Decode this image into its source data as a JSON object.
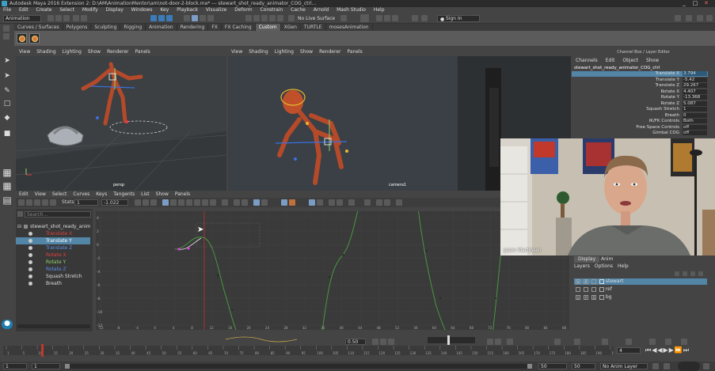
{
  "window": {
    "title": "Autodesk Maya 2016 Extension 2: D:\\AM\\AnimationMentor\\am\\not-door-2-block.ma* --- stewart_shot_ready_animator_COG_ctrl...",
    "controls": [
      "_",
      "□",
      "✕"
    ]
  },
  "menubar": [
    "File",
    "Edit",
    "Create",
    "Select",
    "Modify",
    "Display",
    "Windows",
    "Key",
    "Playback",
    "Visualize",
    "Deform",
    "Constrain",
    "Cache",
    "Arnold",
    "Mash Studio",
    "Help"
  ],
  "statusline": {
    "mode": "Animation",
    "live_surface": "No Live Surface",
    "sign_in": "Sign In"
  },
  "shelf": {
    "tabs": [
      "Curves / Surfaces",
      "Polygons",
      "Sculpting",
      "Rigging",
      "Animation",
      "Rendering",
      "FX",
      "FX Caching",
      "Custom",
      "XGen",
      "TURTLE",
      "mosesAnimation"
    ],
    "active_tab": "Custom"
  },
  "viewports": [
    {
      "menu": [
        "View",
        "Shading",
        "Lighting",
        "Show",
        "Renderer",
        "Panels"
      ],
      "camera": "persp"
    },
    {
      "menu": [
        "View",
        "Shading",
        "Lighting",
        "Show",
        "Renderer",
        "Panels"
      ],
      "camera": "camera1"
    }
  ],
  "graph_editor": {
    "menu": [
      "Edit",
      "View",
      "Select",
      "Curves",
      "Keys",
      "Tangents",
      "List",
      "Show",
      "Panels"
    ],
    "stats_label": "Stats",
    "stats_value_1": "1",
    "stats_value_2": "-1.022",
    "search_placeholder": "Search...",
    "outliner": {
      "object": "stewart_shot_ready_animator",
      "items": [
        {
          "label": "Translate X",
          "color": "#e04040"
        },
        {
          "label": "Translate Y",
          "color": "#8fd16a",
          "selected": true
        },
        {
          "label": "Translate Z",
          "color": "#5a8fe8"
        },
        {
          "label": "Rotate X",
          "color": "#e04040"
        },
        {
          "label": "Rotate Y",
          "color": "#8fd16a"
        },
        {
          "label": "Rotate Z",
          "color": "#5a8fe8"
        },
        {
          "label": "Squash Stretch",
          "color": "#dddddd"
        },
        {
          "label": "Breath",
          "color": "#dddddd"
        }
      ]
    },
    "y_ticks": [
      "4",
      "2",
      "0",
      "-2",
      "-4",
      "-6",
      "-8",
      "-10",
      "-12"
    ],
    "x_ticks": [
      "-12",
      "-8",
      "-4",
      "0",
      "4",
      "8",
      "12",
      "16",
      "20",
      "24",
      "28",
      "32",
      "36",
      "40",
      "44",
      "48",
      "52",
      "56",
      "60",
      "64",
      "68",
      "72",
      "76",
      "80",
      "84",
      "88"
    ],
    "curve_color": "#58b048"
  },
  "channel_box": {
    "title": "Channel Box / Layer Editor",
    "menu": [
      "Channels",
      "Edit",
      "Object",
      "Show"
    ],
    "object": "stewart_shot_ready_animator_COG_ctrl",
    "attributes": [
      {
        "label": "Translate X",
        "value": "3.794",
        "selected": true
      },
      {
        "label": "Translate Y",
        "value": "-5.42"
      },
      {
        "label": "Translate Z",
        "value": "29.267"
      },
      {
        "label": "Rotate X",
        "value": "4.407"
      },
      {
        "label": "Rotate Y",
        "value": "-13.368"
      },
      {
        "label": "Rotate Z",
        "value": "5.087"
      },
      {
        "label": "Squash Stretch",
        "value": "1"
      },
      {
        "label": "Breath",
        "value": "0"
      },
      {
        "label": "IK/FK Controls",
        "value": "Both"
      },
      {
        "label": "Free Space Controls",
        "value": "off"
      },
      {
        "label": "Gimbal COG",
        "value": "off"
      }
    ]
  },
  "webcam": {
    "name": "Jason Martinsen"
  },
  "layer_editor": {
    "tabs": [
      "Display",
      "Anim"
    ],
    "active_tab": "Display",
    "menu": [
      "Layers",
      "Options",
      "Help"
    ],
    "layers": [
      {
        "flags": [
          "V",
          "P",
          ""
        ],
        "name": "stewart",
        "selected": true
      },
      {
        "flags": [
          "",
          "",
          ""
        ],
        "name": "ref"
      },
      {
        "flags": [
          "V",
          "P",
          "R"
        ],
        "name": "bg"
      }
    ]
  },
  "timeslider": {
    "speed_value": "0.50",
    "current_frame": "4",
    "ticks": [
      "1",
      "5",
      "10",
      "15",
      "20",
      "25",
      "30",
      "35",
      "40",
      "45",
      "50",
      "55",
      "60",
      "65",
      "70",
      "75",
      "80",
      "85",
      "90",
      "95",
      "100",
      "105",
      "110",
      "115",
      "120",
      "125",
      "130",
      "135",
      "140",
      "145",
      "150",
      "155",
      "160",
      "165",
      "170",
      "175",
      "180",
      "185",
      "190",
      "195"
    ]
  },
  "range": {
    "start": "1",
    "start2": "1",
    "end": "50",
    "end2": "50",
    "anim_layer": "No Anim Layer"
  }
}
